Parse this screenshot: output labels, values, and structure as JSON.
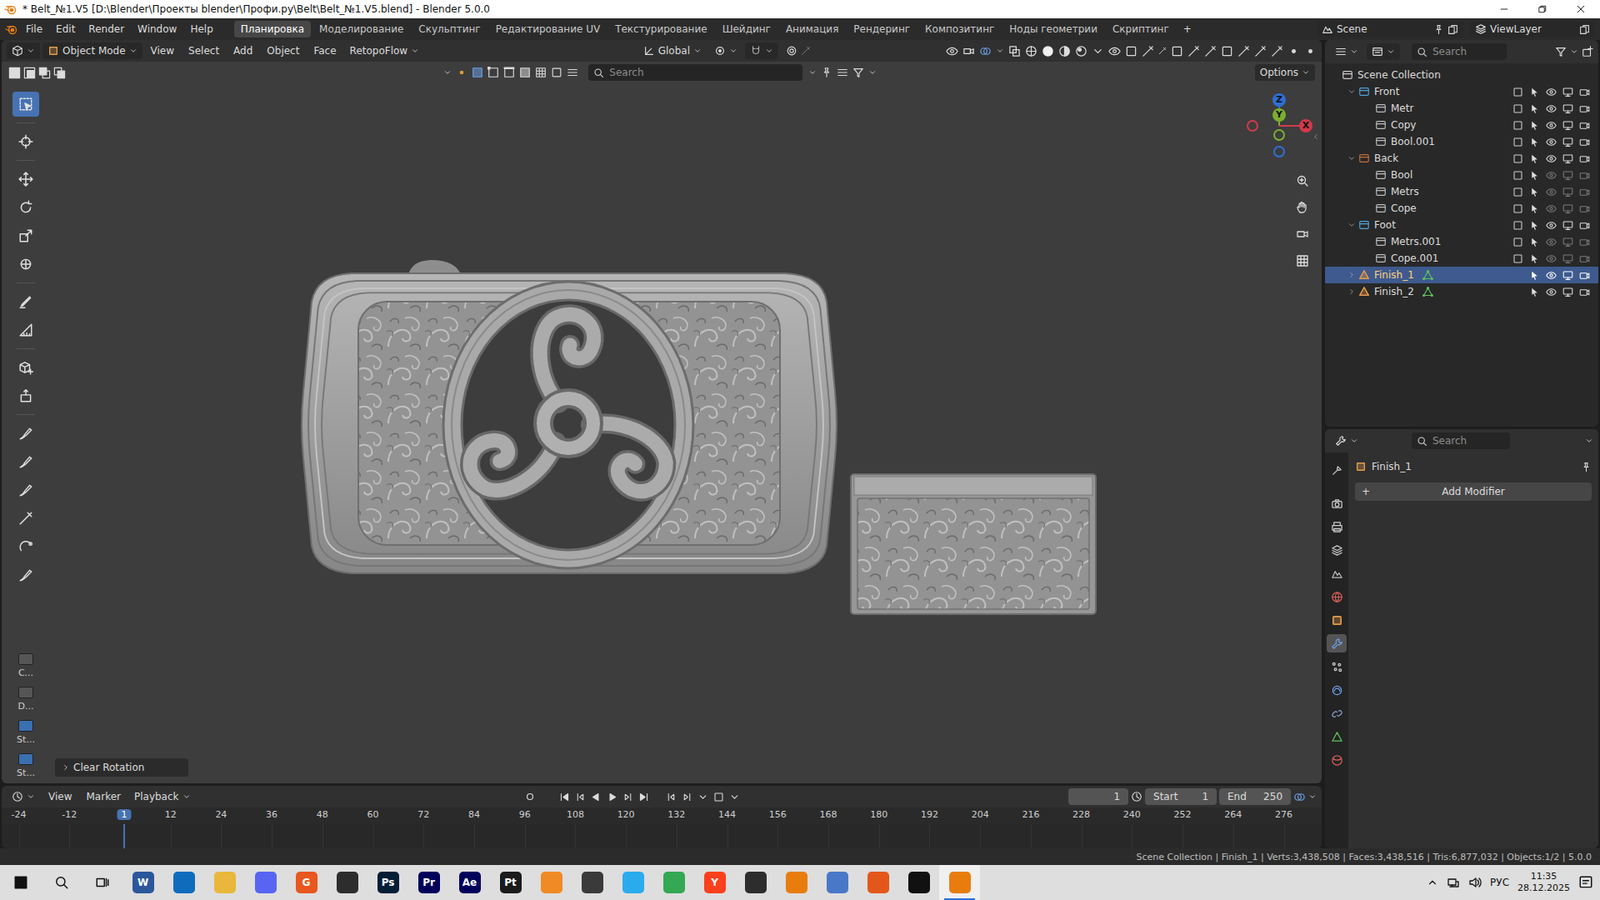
{
  "window": {
    "title": "* Belt_№1.V5 [D:\\Blender\\Проекты blender\\Профи.ру\\Belt\\Belt_№1.V5.blend] - Blender 5.0.0"
  },
  "menu": [
    "File",
    "Edit",
    "Render",
    "Window",
    "Help"
  ],
  "workspaces": [
    {
      "label": "Планировка",
      "selected": true
    },
    {
      "label": "Моделирование",
      "selected": false
    },
    {
      "label": "Скульптинг",
      "selected": false
    },
    {
      "label": "Редактирование UV",
      "selected": false
    },
    {
      "label": "Текстурирование",
      "selected": false
    },
    {
      "label": "Шейдинг",
      "selected": false
    },
    {
      "label": "Анимация",
      "selected": false
    },
    {
      "label": "Рендеринг",
      "selected": false
    },
    {
      "label": "Композитинг",
      "selected": false
    },
    {
      "label": "Ноды геометрии",
      "selected": false
    },
    {
      "label": "Скриптинг",
      "selected": false
    }
  ],
  "workspace_add": "+",
  "scene": "Scene",
  "view_layer": "ViewLayer",
  "viewport": {
    "mode": "Object Mode",
    "menus": [
      "View",
      "Select",
      "Add",
      "Object",
      "Face"
    ],
    "addon_menu": "RetopoFlow",
    "orientation": "Global",
    "search_placeholder": "Search",
    "options": "Options",
    "gizmo": [
      {
        "label": "Z",
        "color": "#2f6fd6"
      },
      {
        "label": "Y",
        "color": "#7bae2e"
      },
      {
        "label": "X",
        "color": "#d23a4a"
      }
    ],
    "tools": [
      {
        "kind": "select",
        "selected": true
      },
      {
        "kind": "cursor",
        "selected": false
      },
      {
        "kind": "move",
        "selected": false
      },
      {
        "kind": "rotate",
        "selected": false
      },
      {
        "kind": "scale",
        "selected": false
      },
      {
        "kind": "transform",
        "selected": false
      },
      {
        "kind": "annotate",
        "selected": false
      },
      {
        "kind": "measure",
        "selected": false
      },
      {
        "kind": "cube-add",
        "selected": false
      },
      {
        "kind": "extrude",
        "selected": false
      },
      {
        "kind": "brush",
        "selected": false
      },
      {
        "kind": "brush",
        "selected": false
      },
      {
        "kind": "brush",
        "selected": false
      },
      {
        "kind": "knife",
        "selected": false
      },
      {
        "kind": "spin",
        "selected": false
      },
      {
        "kind": "brush",
        "selected": false
      }
    ],
    "toolbar_props": [
      {
        "label": "C...",
        "color": "#555555"
      },
      {
        "label": "D...",
        "color": "#555555"
      },
      {
        "label": "St...",
        "color": "#3a6fb0"
      },
      {
        "label": "St...",
        "color": "#3a6fb0"
      }
    ],
    "operator_panel": {
      "label": "Clear Rotation",
      "expanded": false
    }
  },
  "outliner": {
    "search_placeholder": "Search",
    "items": [
      {
        "label": "Scene Collection",
        "kind": "scene",
        "depth": 0,
        "expanded": true,
        "selected": false,
        "visible": true,
        "color": "#cccccc"
      },
      {
        "label": "Front",
        "kind": "group",
        "depth": 1,
        "expanded": true,
        "selected": false,
        "visible": true,
        "checked": false,
        "color": "#4fa3d9"
      },
      {
        "label": "Metr",
        "kind": "collection",
        "depth": 2,
        "expanded": false,
        "selected": false,
        "visible": true,
        "checked": false,
        "color": "#bdbdbd"
      },
      {
        "label": "Copy",
        "kind": "collection",
        "depth": 2,
        "expanded": false,
        "selected": false,
        "visible": true,
        "checked": false,
        "color": "#bdbdbd"
      },
      {
        "label": "Bool.001",
        "kind": "collection",
        "depth": 2,
        "expanded": false,
        "selected": false,
        "visible": true,
        "checked": false,
        "color": "#bdbdbd"
      },
      {
        "label": "Back",
        "kind": "group",
        "depth": 1,
        "expanded": true,
        "selected": false,
        "visible": true,
        "checked": false,
        "color": "#c0703a"
      },
      {
        "label": "Bool",
        "kind": "collection",
        "depth": 2,
        "expanded": false,
        "selected": false,
        "visible": false,
        "checked": false,
        "color": "#bdbdbd"
      },
      {
        "label": "Metrs",
        "kind": "collection",
        "depth": 2,
        "expanded": false,
        "selected": false,
        "visible": false,
        "checked": false,
        "color": "#bdbdbd"
      },
      {
        "label": "Cope",
        "kind": "collection",
        "depth": 2,
        "expanded": false,
        "selected": false,
        "visible": false,
        "checked": false,
        "color": "#bdbdbd"
      },
      {
        "label": "Foot",
        "kind": "group",
        "depth": 1,
        "expanded": true,
        "selected": false,
        "visible": true,
        "checked": false,
        "color": "#4fa3d9"
      },
      {
        "label": "Metrs.001",
        "kind": "collection",
        "depth": 2,
        "expanded": false,
        "selected": false,
        "visible": false,
        "checked": false,
        "color": "#bdbdbd"
      },
      {
        "label": "Cope.001",
        "kind": "collection",
        "depth": 2,
        "expanded": false,
        "selected": false,
        "visible": false,
        "checked": false,
        "color": "#bdbdbd"
      },
      {
        "label": "Finish_1",
        "kind": "object",
        "depth": 1,
        "expanded": false,
        "selected": true,
        "visible": true,
        "color": "#e69a4a"
      },
      {
        "label": "Finish_2",
        "kind": "object",
        "depth": 1,
        "expanded": false,
        "selected": false,
        "visible": true,
        "color": "#e69a4a"
      }
    ]
  },
  "properties": {
    "search_placeholder": "Search",
    "object": "Finish_1",
    "add_modifier": "Add Modifier",
    "add_icon": "+",
    "tabs": [
      {
        "kind": "tool",
        "selected": false
      },
      {
        "kind": "render",
        "selected": false
      },
      {
        "kind": "output",
        "selected": false
      },
      {
        "kind": "view-layer",
        "selected": false
      },
      {
        "kind": "scene",
        "selected": false
      },
      {
        "kind": "world",
        "selected": false
      },
      {
        "kind": "object",
        "selected": false
      },
      {
        "kind": "modifier",
        "selected": true
      },
      {
        "kind": "particles",
        "selected": false
      },
      {
        "kind": "physics",
        "selected": false
      },
      {
        "kind": "constraints",
        "selected": false
      },
      {
        "kind": "data",
        "selected": false
      },
      {
        "kind": "material",
        "selected": false
      }
    ]
  },
  "timeline": {
    "menus": [
      "View",
      "Marker"
    ],
    "playback": "Playback",
    "current_frame": "1",
    "start_label": "Start",
    "start": "1",
    "end_label": "End",
    "end": "250",
    "ruler": [
      {
        "label": "-24",
        "selected": false
      },
      {
        "label": "-12",
        "selected": false
      },
      {
        "label": "1",
        "selected": true
      },
      {
        "label": "12",
        "selected": false
      },
      {
        "label": "24",
        "selected": false
      },
      {
        "label": "36",
        "selected": false
      },
      {
        "label": "48",
        "selected": false
      },
      {
        "label": "60",
        "selected": false
      },
      {
        "label": "72",
        "selected": false
      },
      {
        "label": "84",
        "selected": false
      },
      {
        "label": "96",
        "selected": false
      },
      {
        "label": "108",
        "selected": false
      },
      {
        "label": "120",
        "selected": false
      },
      {
        "label": "132",
        "selected": false
      },
      {
        "label": "144",
        "selected": false
      },
      {
        "label": "156",
        "selected": false
      },
      {
        "label": "168",
        "selected": false
      },
      {
        "label": "180",
        "selected": false
      },
      {
        "label": "192",
        "selected": false
      },
      {
        "label": "204",
        "selected": false
      },
      {
        "label": "216",
        "selected": false
      },
      {
        "label": "228",
        "selected": false
      },
      {
        "label": "240",
        "selected": false
      },
      {
        "label": "252",
        "selected": false
      },
      {
        "label": "264",
        "selected": false
      },
      {
        "label": "276",
        "selected": false
      }
    ]
  },
  "status_bar": {
    "text": "Scene Collection | Finish_1 | Verts:3,438,508 | Faces:3,438,516 | Tris:6,877,032 | Objects:1/2 | 5.0.0"
  },
  "taskbar": {
    "apps": [
      {
        "label": "W",
        "color": "#2b579a",
        "selected": false
      },
      {
        "label": "",
        "color": "#0f6cbd",
        "selected": false
      },
      {
        "label": "",
        "color": "#e9b73c",
        "selected": false
      },
      {
        "label": "",
        "color": "#5865f2",
        "selected": false
      },
      {
        "label": "G",
        "color": "#e8571e",
        "selected": false
      },
      {
        "label": "",
        "color": "#2d2d2d",
        "selected": false
      },
      {
        "label": "Ps",
        "color": "#001e36",
        "selected": false
      },
      {
        "label": "Pr",
        "color": "#00005b",
        "selected": false
      },
      {
        "label": "Ae",
        "color": "#00005b",
        "selected": false
      },
      {
        "label": "Pt",
        "color": "#1b1b1b",
        "selected": false
      },
      {
        "label": "",
        "color": "#f08a24",
        "selected": false
      },
      {
        "label": "",
        "color": "#3a3a3a",
        "selected": false
      },
      {
        "label": "",
        "color": "#2aabee",
        "selected": false
      },
      {
        "label": "",
        "color": "#34a853",
        "selected": false
      },
      {
        "label": "Y",
        "color": "#fc3f1d",
        "selected": false
      },
      {
        "label": "",
        "color": "#2d2d2d",
        "selected": false
      },
      {
        "label": "",
        "color": "#e87d0d",
        "selected": false
      },
      {
        "label": "",
        "color": "#4a78c8",
        "selected": false
      },
      {
        "label": "",
        "color": "#e4571b",
        "selected": false
      },
      {
        "label": "",
        "color": "#111111",
        "selected": false
      },
      {
        "label": "",
        "color": "#e87d0d",
        "selected": true
      }
    ],
    "lang": "РУС",
    "time": "11:35",
    "date": "28.12.2025"
  }
}
